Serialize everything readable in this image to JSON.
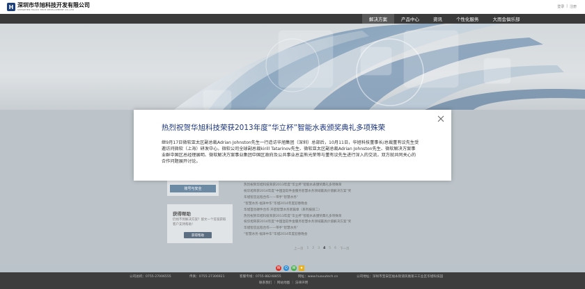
{
  "header": {
    "logo_mark": "H",
    "company_cn": "深圳市华旭科技开发有限公司",
    "company_en": "SHENZHEN HUAXU TECH DEVELOPMENT CO.,LTD",
    "top_links": [
      "登录",
      "注册"
    ]
  },
  "nav": {
    "items": [
      "解决方案",
      "产品中心",
      "资讯",
      "个性化服务",
      "大而会俱乐部"
    ],
    "active_index": 0
  },
  "modal": {
    "title": "热烈祝贺华旭科技荣获2013年度“华立杯”智能水表颁奖典礼多项殊荣",
    "body": "继9月17日微软亚太区副总裁Adrian Johnston先生一行造访华旭集团（深圳）总部后，10月11日，华旭科技董事长/总裁董有议先生受邀访问微软（上海）研发中心。微软公司全球副总裁kirill Tatarinov先生、微软亚太区副总裁Adrian Johnston先生、微软解决方案事业群中国区总经理展明、微软解决方案事业集团中国区政府及公共事业总监熊光荣等与董有议先生进行深入的交流，双方就共同关心的合作问题展开讨论。"
  },
  "sidebar": {
    "button_label": "账号与安全",
    "help_title": "获得帮助",
    "help_text": "仍找不到解决方案？留文一个答案获取客户支持帮助！",
    "help_button": "获得帮助"
  },
  "news": [
    "热烈祝贺华旭科技荣获2013年度“华立杯”智能水表颁奖典礼多项殊荣",
    "祝华旭荣获2014年度“中国温软件金服务智慧水务领域最具价值解决方案”奖",
    "华旭智造远程合作——带手“智慧水务”",
    "“智慧水务·福泽中华”华旭2014年度迎春晚会",
    "华旭首创硬件合作 开启智慧水务新篇章（系列报道二）",
    "热烈祝贺华旭科技荣获2013年度“华立杯”智能水表颁奖典礼多项殊荣",
    "祝华旭荣获2014年度“中国温软件金服务智慧水务领域最具价值解决方案”奖",
    "华旭智造远程合作——带手“智慧水务”",
    "“智慧水务·福泽中华”华旭2014年度迎春晚会"
  ],
  "pager": {
    "prev": "上一页",
    "pages": [
      "1",
      "2",
      "3",
      "4",
      "5",
      "6"
    ],
    "current": "4",
    "next": "下一页"
  },
  "footer": {
    "phone": "公司总机：0755-27006555",
    "fax": "传真：0755-27306921",
    "service": "客服专线：0755-88248855",
    "web": "网址：www.huaxutech.cn",
    "address": "公司地址：深圳市宝安区福永街道凤凰第三工业区华旭科技园",
    "links": "联系我们 ｜ 网站地图 ｜ 法律声明"
  },
  "colors": {
    "nav_bg": "#3a3a3a",
    "modal_title": "#1b3580",
    "footer_bg": "#3d3d3d"
  }
}
